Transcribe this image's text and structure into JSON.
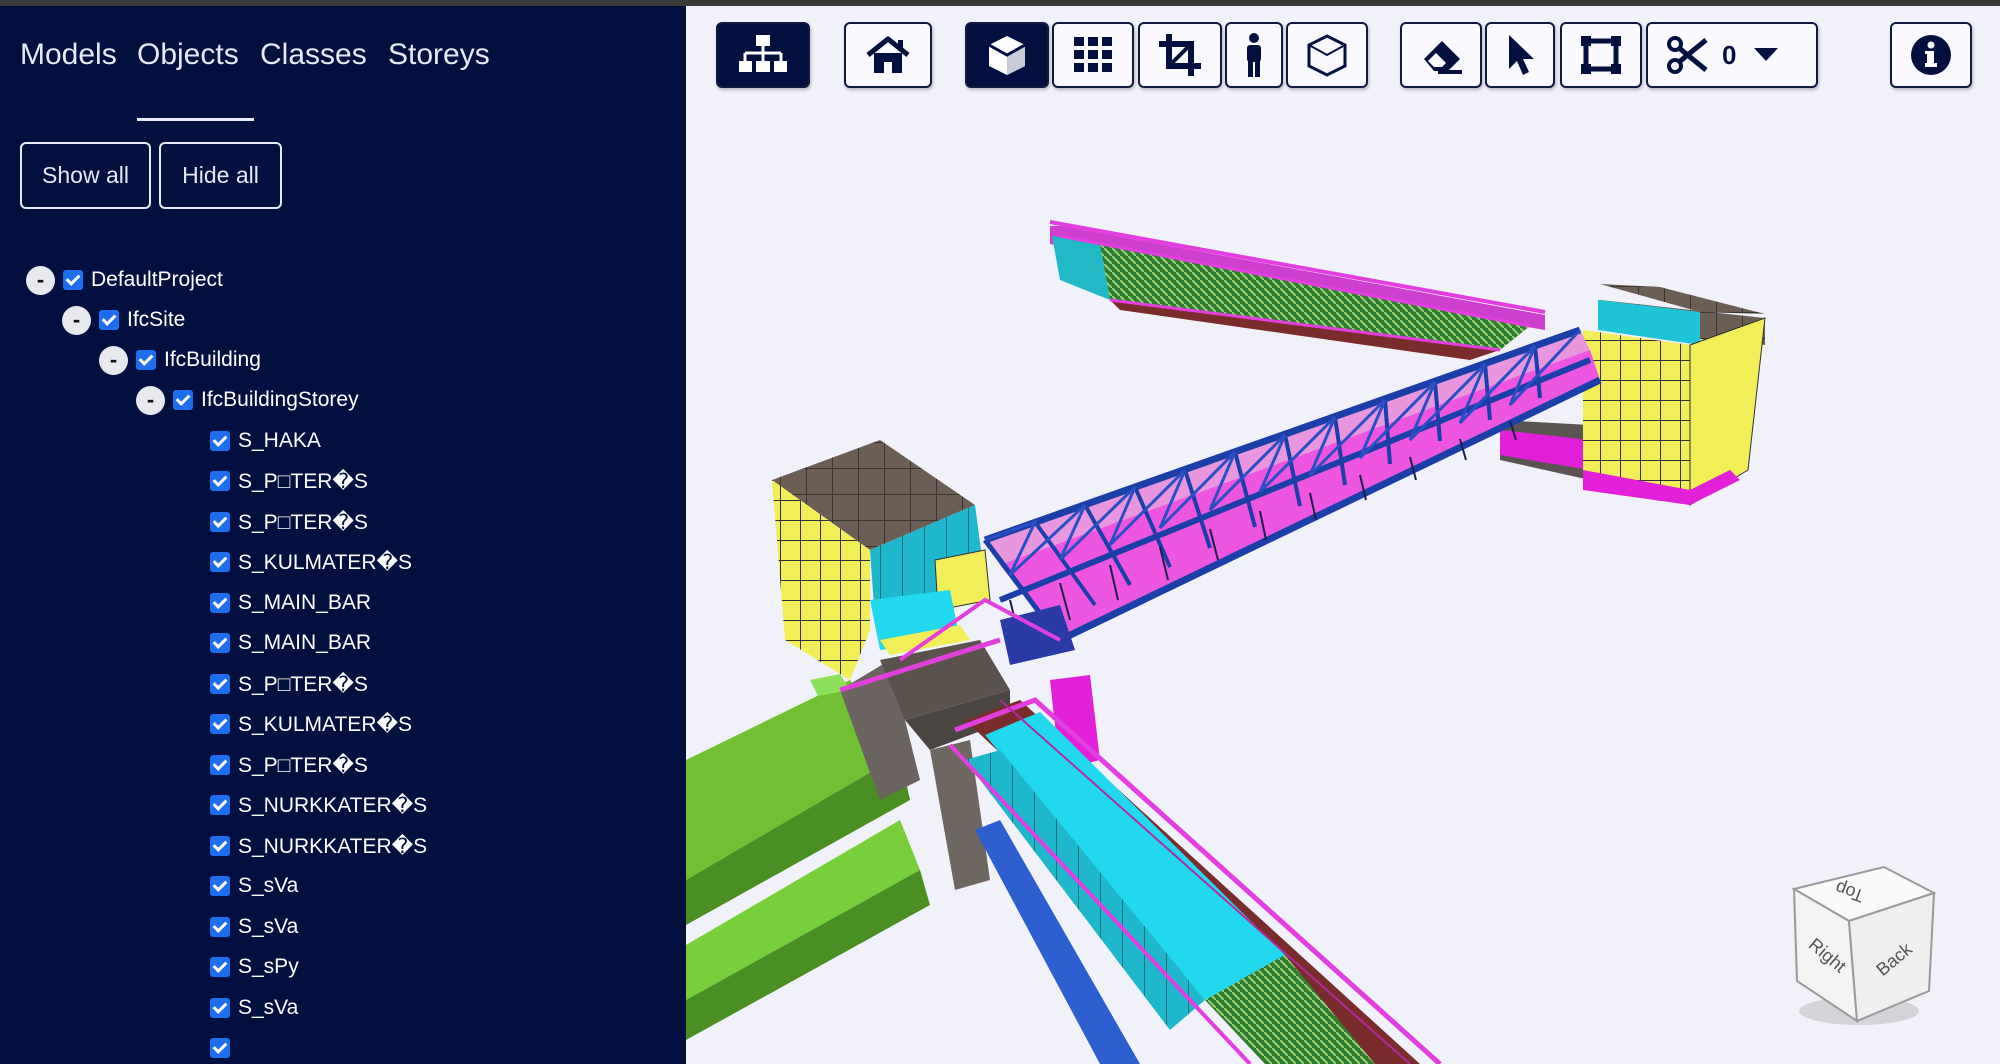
{
  "sidebar": {
    "tabs": [
      "Models",
      "Objects",
      "Classes",
      "Storeys"
    ],
    "active_tab": "Objects",
    "show_all_label": "Show all",
    "hide_all_label": "Hide all",
    "tree": {
      "root": "DefaultProject",
      "site": "IfcSite",
      "building": "IfcBuilding",
      "storey": "IfcBuildingStorey",
      "toggle_symbol": "-",
      "objects": [
        "S_HAKA",
        "S_P□TER�S",
        "S_P□TER�S",
        "S_KULMATER�S",
        "S_MAIN_BAR",
        "S_MAIN_BAR",
        "S_P□TER�S",
        "S_KULMATER�S",
        "S_P□TER�S",
        "S_NURKKATER�S",
        "S_NURKKATER�S",
        "S_sVa",
        "S_sVa",
        "S_sPy",
        "S_sVa"
      ]
    }
  },
  "toolbar": {
    "section_count": "0",
    "buttons": [
      "tree-view-icon",
      "home-icon",
      "perspective-cube-icon",
      "ortho-grid-icon",
      "fit-crop-icon",
      "first-person-icon",
      "xray-icon",
      "erase-icon",
      "select-cursor-icon",
      "marquee-select-icon",
      "section-scissors-icon",
      "info-icon"
    ]
  },
  "navcube": {
    "top": "Top",
    "right": "Right",
    "back": "Back"
  },
  "colors": {
    "sidebar_bg": "#030f3f",
    "viewport_bg": "#f1f1fa",
    "checkbox": "#1e6ff0",
    "truss_blue": "#1a3fa8",
    "magenta": "#e23ee0",
    "cyan": "#22d8ee",
    "green": "#6fc132",
    "yellow": "#f2ee57"
  }
}
